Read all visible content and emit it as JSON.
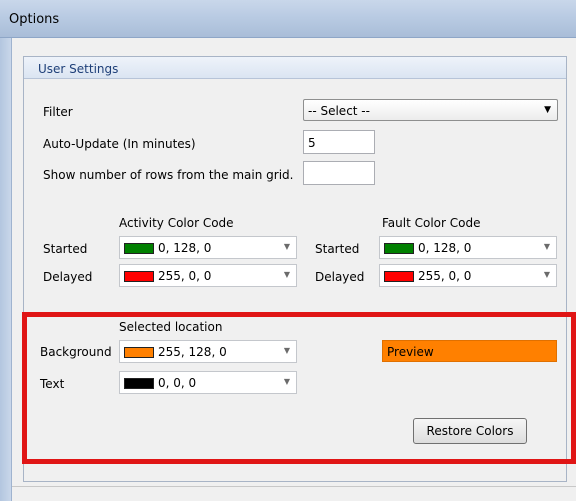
{
  "window": {
    "title": "Options"
  },
  "group": {
    "title": "User Settings"
  },
  "filter": {
    "label": "Filter",
    "selected": "-- Select --"
  },
  "auto_update": {
    "label": "Auto-Update (In minutes)",
    "value": "5"
  },
  "row_count": {
    "label": "Show number of rows from the main grid.",
    "value": ""
  },
  "activity": {
    "header": "Activity Color Code",
    "started": {
      "label": "Started",
      "value": "0, 128, 0",
      "color": "#008000"
    },
    "delayed": {
      "label": "Delayed",
      "value": "255, 0, 0",
      "color": "#ff0000"
    }
  },
  "fault": {
    "header": "Fault Color Code",
    "started": {
      "label": "Started",
      "value": "0, 128, 0",
      "color": "#008000"
    },
    "delayed": {
      "label": "Delayed",
      "value": "255, 0, 0",
      "color": "#ff0000"
    }
  },
  "selected_location": {
    "header": "Selected location",
    "background": {
      "label": "Background",
      "value": "255, 128, 0",
      "color": "#ff8000"
    },
    "text": {
      "label": "Text",
      "value": "0, 0, 0",
      "color": "#000000"
    },
    "preview_label": "Preview",
    "restore_button": "Restore Colors"
  },
  "colors": {
    "highlight_border": "#e01515",
    "group_title": "#1e3f78"
  },
  "icons": {
    "dropdown": "dropdown-arrow-icon"
  }
}
